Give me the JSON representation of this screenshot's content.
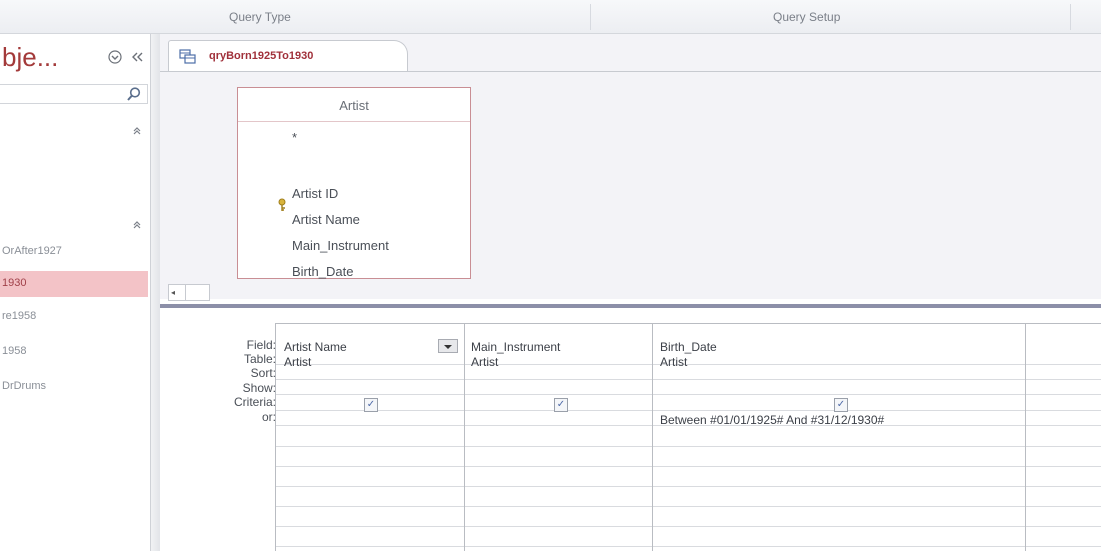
{
  "ribbon": {
    "groups": [
      "Query Type",
      "Query Setup"
    ]
  },
  "nav_pane": {
    "title": "bje...",
    "menu_icon": "circle-chevron-icon",
    "collapse_icon": "double-chevron-left-icon",
    "items": [
      "OrAfter1927",
      "1930",
      "re1958",
      "1958",
      "DrDrums"
    ],
    "selected_index": 1
  },
  "document_tab": {
    "label": "qryBorn1925To1930",
    "icon": "query-icon"
  },
  "table": {
    "name": "Artist",
    "fields": [
      "*",
      "Artist ID",
      "Artist Name",
      "Main_Instrument",
      "Birth_Date"
    ],
    "primary_key_index": 1
  },
  "design_grid": {
    "row_labels": [
      "Field:",
      "Table:",
      "Sort:",
      "Show:",
      "Criteria:",
      "or:"
    ],
    "columns": [
      {
        "field": "Artist Name",
        "table": "Artist",
        "show": true,
        "criteria": ""
      },
      {
        "field": "Main_Instrument",
        "table": "Artist",
        "show": true,
        "criteria": ""
      },
      {
        "field": "Birth_Date",
        "table": "Artist",
        "show": true,
        "criteria": "Between #01/01/1925# And #31/12/1930#"
      }
    ]
  },
  "colors": {
    "accent": "#a33a3a",
    "selected_item_bg": "#f3c3c7",
    "splitter": "#8c8fa8"
  }
}
